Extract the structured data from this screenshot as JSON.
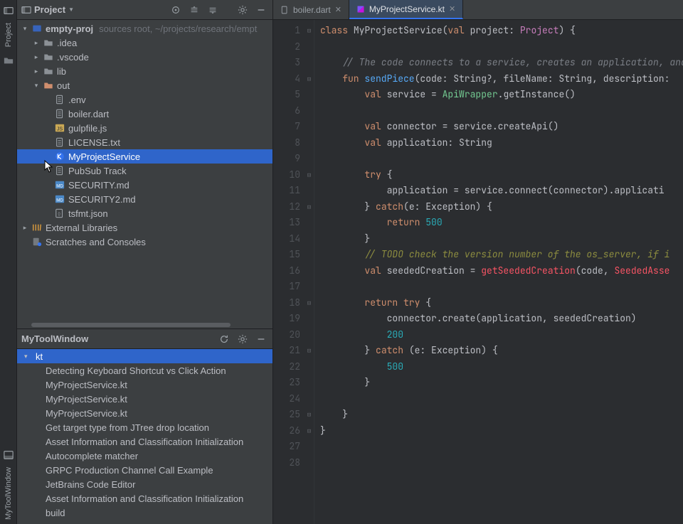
{
  "leftStripe": {
    "top_label": "Project",
    "bottom_label": "MyToolWindow"
  },
  "projectPane": {
    "title": "Project",
    "root": {
      "name": "empty-proj",
      "hint": "sources root, ~/projects/research/empt"
    },
    "items": [
      {
        "name": ".idea",
        "kind": "folder",
        "arrow": "right"
      },
      {
        "name": ".vscode",
        "kind": "folder",
        "arrow": "right"
      },
      {
        "name": "lib",
        "kind": "folder",
        "arrow": "right"
      },
      {
        "name": "out",
        "kind": "folder-open",
        "arrow": "down"
      },
      {
        "name": ".env",
        "kind": "file"
      },
      {
        "name": "boiler.dart",
        "kind": "file"
      },
      {
        "name": "gulpfile.js",
        "kind": "js"
      },
      {
        "name": "LICENSE.txt",
        "kind": "file"
      },
      {
        "name": "MyProjectService",
        "kind": "kt",
        "selected": true
      },
      {
        "name": "PubSub Track",
        "kind": "file"
      },
      {
        "name": "SECURITY.md",
        "kind": "md"
      },
      {
        "name": "SECURITY2.md",
        "kind": "md"
      },
      {
        "name": "tsfmt.json",
        "kind": "json"
      }
    ],
    "extLibs": "External Libraries",
    "scratches": "Scratches and Consoles"
  },
  "editor": {
    "tabs": [
      {
        "label": "boiler.dart",
        "active": false
      },
      {
        "label": "MyProjectService.kt",
        "active": true
      }
    ],
    "lineCount": 28,
    "code": [
      [
        [
          "kw",
          "class "
        ],
        [
          "",
          "MyProjectService("
        ],
        [
          "kw",
          "val"
        ],
        [
          "",
          " project: "
        ],
        [
          "cls",
          "Project"
        ],
        [
          "",
          ") {"
        ]
      ],
      [],
      [
        [
          "cmt",
          "    // The code connects to a service, creates an application, and "
        ]
      ],
      [
        [
          "",
          "    "
        ],
        [
          "kw",
          "fun "
        ],
        [
          "fn",
          "sendPiece"
        ],
        [
          "",
          "(code: String?, fileName: String, description:"
        ]
      ],
      [
        [
          "",
          "        "
        ],
        [
          "kw",
          "val"
        ],
        [
          "",
          " service = "
        ],
        [
          "grn",
          "ApiWrapper"
        ],
        [
          "",
          ".getInstance()"
        ]
      ],
      [],
      [
        [
          "",
          "        "
        ],
        [
          "kw",
          "val"
        ],
        [
          "",
          " connector = service.createApi()"
        ]
      ],
      [
        [
          "",
          "        "
        ],
        [
          "kw",
          "val"
        ],
        [
          "",
          " application: String"
        ]
      ],
      [],
      [
        [
          "",
          "        "
        ],
        [
          "kw",
          "try"
        ],
        [
          "",
          " {"
        ]
      ],
      [
        [
          "",
          "            application = service.connect(connector).applicati"
        ]
      ],
      [
        [
          "",
          "        } "
        ],
        [
          "kw",
          "catch"
        ],
        [
          "",
          "(e: Exception) {"
        ]
      ],
      [
        [
          "",
          "            "
        ],
        [
          "kw",
          "return "
        ],
        [
          "num",
          "500"
        ]
      ],
      [
        [
          "",
          "        }"
        ]
      ],
      [
        [
          "",
          "        "
        ],
        [
          "todo",
          "// TODO check the version number of the os_server, if i"
        ]
      ],
      [
        [
          "",
          "        "
        ],
        [
          "kw",
          "val"
        ],
        [
          "",
          " seededCreation = "
        ],
        [
          "red",
          "getSeededCreation"
        ],
        [
          "",
          "(code, "
        ],
        [
          "red",
          "SeededAsse"
        ]
      ],
      [],
      [
        [
          "",
          "        "
        ],
        [
          "kw",
          "return try"
        ],
        [
          "",
          " {"
        ]
      ],
      [
        [
          "",
          "            connector.create(application, seededCreation)"
        ]
      ],
      [
        [
          "",
          "            "
        ],
        [
          "num",
          "200"
        ]
      ],
      [
        [
          "",
          "        } "
        ],
        [
          "kw",
          "catch"
        ],
        [
          "",
          " (e: Exception) {"
        ]
      ],
      [
        [
          "",
          "            "
        ],
        [
          "num",
          "500"
        ]
      ],
      [
        [
          "",
          "        }"
        ]
      ],
      [],
      [
        [
          "",
          "    }"
        ]
      ],
      [
        [
          "",
          "}"
        ]
      ],
      [],
      []
    ]
  },
  "bottom": {
    "title": "MyToolWindow",
    "root": "kt",
    "items": [
      "Detecting Keyboard Shortcut vs Click Action",
      "MyProjectService.kt",
      "MyProjectService.kt",
      "MyProjectService.kt",
      "Get target type from JTree drop location",
      "Asset Information and Classification Initialization",
      "Autocomplete matcher",
      "GRPC Production Channel Call Example",
      "JetBrains Code Editor",
      "Asset Information and Classification Initialization",
      "build"
    ]
  }
}
